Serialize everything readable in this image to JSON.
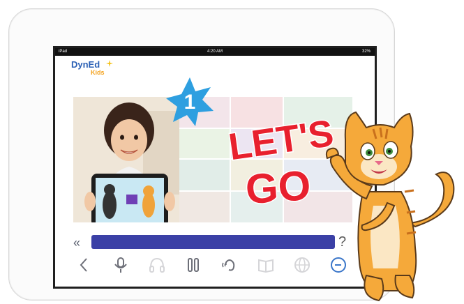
{
  "status_bar": {
    "device": "iPad",
    "time": "4:20 AM",
    "battery": "32%"
  },
  "logo": {
    "brand": "DynEd",
    "sub": "Kids"
  },
  "lesson": {
    "number": "1",
    "title_line1": "LET'S",
    "title_line2": "GO"
  },
  "progress": {
    "value": 1.0
  },
  "controls": {
    "rewind_label": "«",
    "help_label": "?"
  },
  "colors": {
    "progress": "#3b40a6",
    "title_red": "#e8202e",
    "badge_blue": "#2e9fe0",
    "cat_orange": "#f5a93a"
  },
  "icons": [
    "back-icon",
    "microphone-icon",
    "headphones-icon",
    "pause-icon",
    "hearing-icon",
    "book-icon",
    "globe-icon",
    "clock-icon"
  ]
}
